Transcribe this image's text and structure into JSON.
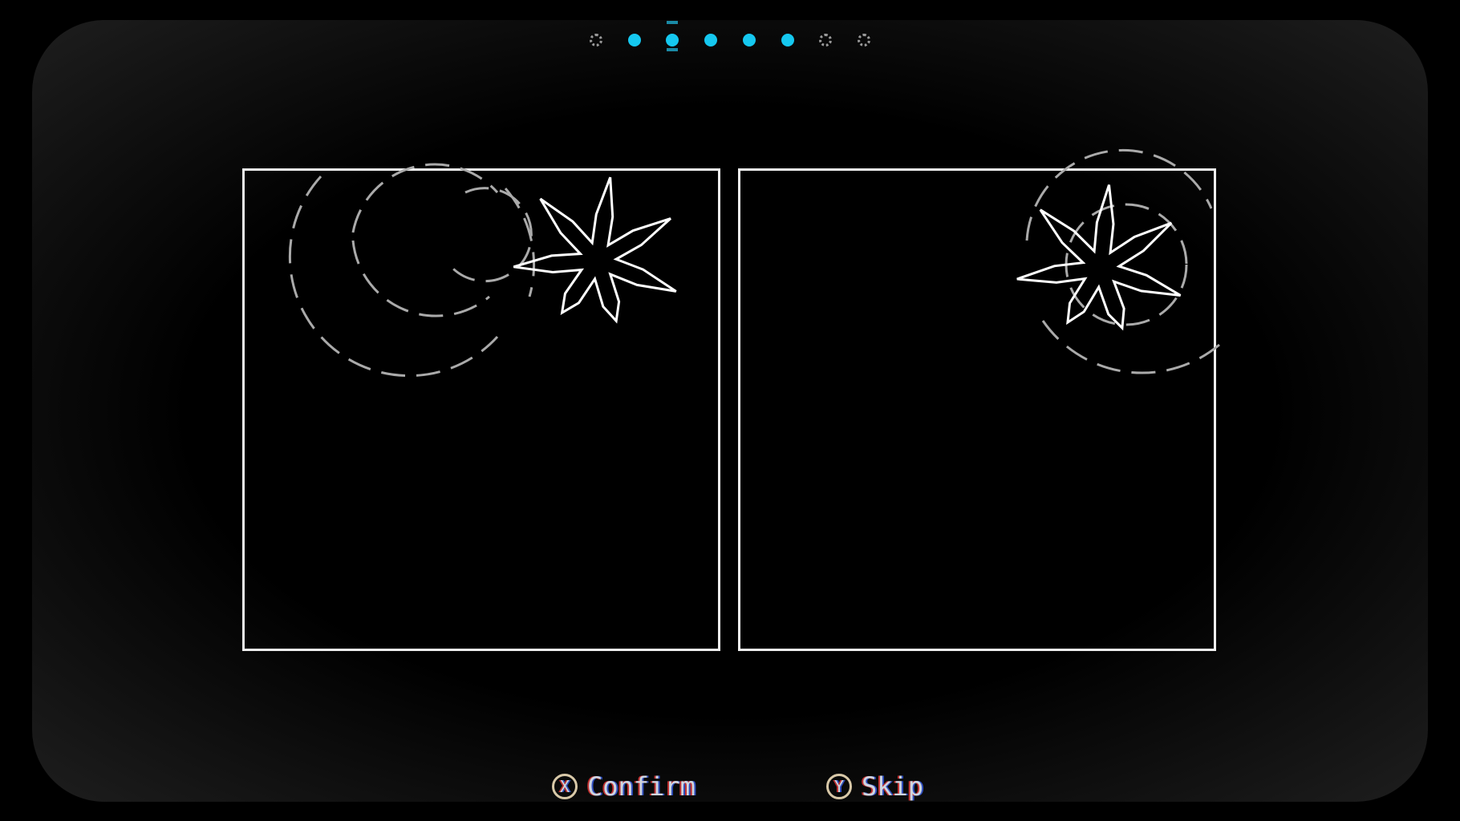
{
  "progress": {
    "total": 8,
    "filled": [
      1,
      2,
      3,
      4,
      5
    ],
    "current": 2,
    "active_color": "#15c8f0"
  },
  "controls": {
    "confirm": {
      "button": "X",
      "label": "Confirm"
    },
    "skip": {
      "button": "Y",
      "label": "Skip"
    }
  }
}
